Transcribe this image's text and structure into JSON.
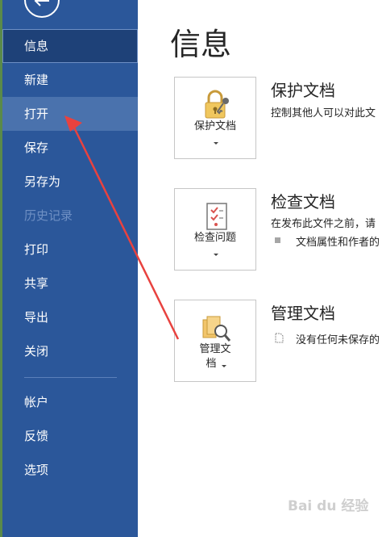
{
  "sidebar": {
    "items": [
      {
        "label": "信息",
        "state": "selected"
      },
      {
        "label": "新建",
        "state": "normal"
      },
      {
        "label": "打开",
        "state": "hover"
      },
      {
        "label": "保存",
        "state": "normal"
      },
      {
        "label": "另存为",
        "state": "normal"
      },
      {
        "label": "历史记录",
        "state": "disabled"
      },
      {
        "label": "打印",
        "state": "normal"
      },
      {
        "label": "共享",
        "state": "normal"
      },
      {
        "label": "导出",
        "state": "normal"
      },
      {
        "label": "关闭",
        "state": "normal"
      },
      {
        "label": "帐户",
        "state": "normal"
      },
      {
        "label": "反馈",
        "state": "normal"
      },
      {
        "label": "选项",
        "state": "normal"
      }
    ],
    "back_icon": "back-arrow-icon"
  },
  "main": {
    "title": "信息",
    "sections": {
      "protect": {
        "button_label": "保护文档",
        "icon": "lock-key-icon",
        "title": "保护文档",
        "description": "控制其他人可以对此文"
      },
      "inspect": {
        "button_label": "检查问题",
        "icon": "checklist-icon",
        "title": "检查文档",
        "description": "在发布此文件之前，请",
        "item": "文档属性和作者的"
      },
      "manage": {
        "button_label_line1": "管理文",
        "button_label_line2": "档",
        "icon": "manage-docs-icon",
        "title": "管理文档",
        "item": "没有任何未保存的"
      }
    }
  },
  "watermark": "Bai du 经验",
  "colors": {
    "sidebar_bg": "#2b579a",
    "selected_bg": "#1e4178",
    "hover_bg": "#4a72ad",
    "annotation_arrow": "#e8423f"
  }
}
